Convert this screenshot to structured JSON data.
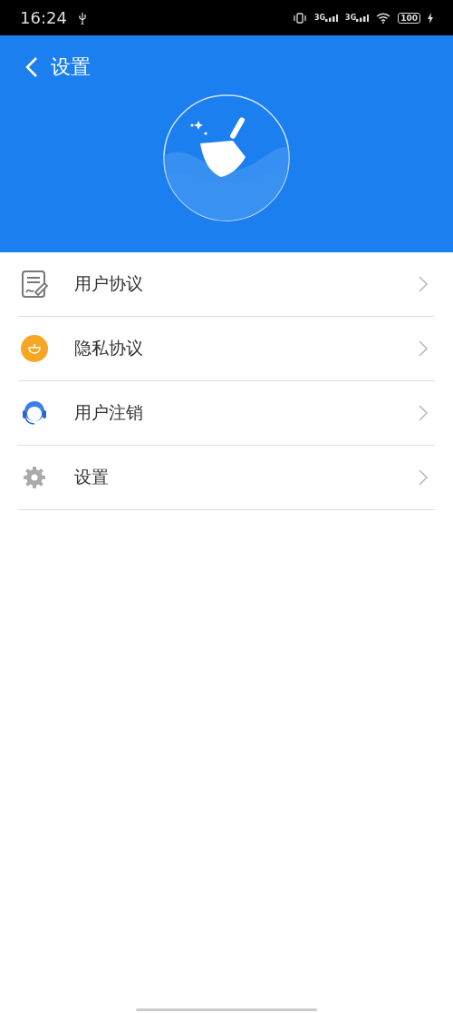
{
  "status_bar": {
    "time": "16:24",
    "network_1": "3G",
    "network_2": "3G",
    "battery": "100"
  },
  "header": {
    "title": "设置"
  },
  "items": [
    {
      "kind": "document",
      "label": "用户协议"
    },
    {
      "kind": "bowl",
      "label": "隐私协议"
    },
    {
      "kind": "headset",
      "label": "用户注销"
    },
    {
      "kind": "gear",
      "label": "设置"
    }
  ]
}
